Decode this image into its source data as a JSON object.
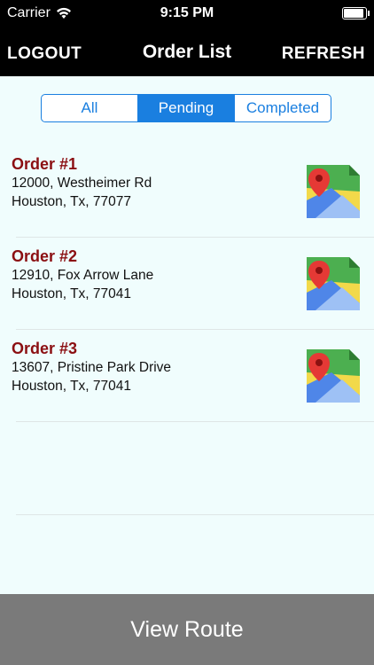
{
  "status_bar": {
    "carrier": "Carrier",
    "time": "9:15 PM",
    "battery_level": 1.0
  },
  "nav": {
    "left_button": "LOGOUT",
    "title": "Order List",
    "right_button": "REFRESH"
  },
  "filter_tabs": [
    {
      "label": "All",
      "selected": false
    },
    {
      "label": "Pending",
      "selected": true
    },
    {
      "label": "Completed",
      "selected": false
    }
  ],
  "orders": [
    {
      "title": "Order #1",
      "address": "12000, Westheimer Rd",
      "city": "Houston, Tx, 77077"
    },
    {
      "title": "Order #2",
      "address": "12910, Fox Arrow Lane",
      "city": "Houston, Tx, 77041"
    },
    {
      "title": "Order #3",
      "address": "13607, Pristine Park Drive",
      "city": "Houston, Tx, 77041"
    }
  ],
  "map_icon": "maps-pin-icon",
  "view_route_label": "View Route",
  "colors": {
    "accent": "#1a7fe0",
    "order_title": "#8b0f12",
    "bottom_bar": "#7a7a7a"
  }
}
